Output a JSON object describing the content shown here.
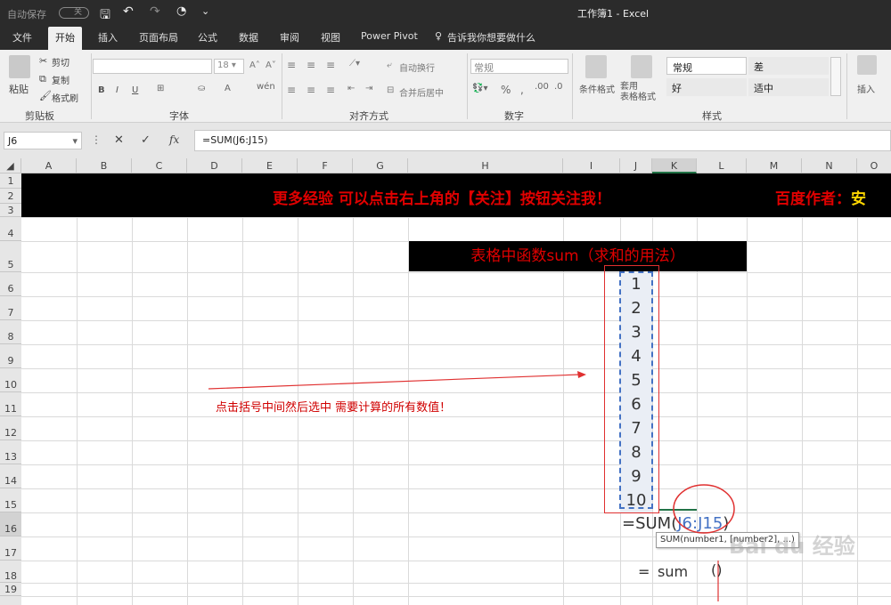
{
  "titlebar": {
    "autosave": "自动保存",
    "toggle": "关",
    "title": "工作簿1  -  Excel"
  },
  "tabs": [
    "文件",
    "开始",
    "插入",
    "页面布局",
    "公式",
    "数据",
    "审阅",
    "视图",
    "Power Pivot"
  ],
  "tell_me": "告诉我你想要做什么",
  "ribbon": {
    "paste": "粘贴",
    "cut": "剪切",
    "copy": "复制",
    "format_painter": "格式刷",
    "clipboard": "剪贴板",
    "font_size": "18",
    "font_group": "字体",
    "wrap": "自动换行",
    "merge": "合并后居中",
    "align_group": "对齐方式",
    "number_format": "常规",
    "number_group": "数字",
    "cond_format": "条件格式",
    "table_format": "套用\n表格格式",
    "style_normal": "常规",
    "style_bad": "差",
    "style_good": "好",
    "style_neutral": "适中",
    "style_group": "样式",
    "insert": "插入"
  },
  "formula_bar": {
    "name_box": "J6",
    "formula": "=SUM(J6:J15)"
  },
  "columns": [
    "A",
    "B",
    "C",
    "D",
    "E",
    "F",
    "G",
    "H",
    "I",
    "J",
    "K",
    "L",
    "M",
    "N",
    "O"
  ],
  "rows": [
    "1",
    "2",
    "3",
    "4",
    "5",
    "6",
    "7",
    "8",
    "9",
    "10",
    "11",
    "12",
    "13",
    "14",
    "15",
    "16",
    "17",
    "18",
    "19"
  ],
  "sheet": {
    "banner": "更多经验 可以点击右上角的【关注】按钮关注我！",
    "author": "百度作者：安",
    "header_box": "表格中函数sum（求和的用法）",
    "values": [
      "1",
      "2",
      "3",
      "4",
      "5",
      "6",
      "7",
      "8",
      "9",
      "10"
    ],
    "annotation": "点击括号中间然后选中 需要计算的所有数值！",
    "formula_eq": "=SUM(",
    "formula_ref": "J6:J15",
    "formula_close": ")",
    "tooltip": "SUM(number1, [number2], ...)",
    "bottom_eq": "=",
    "bottom_sum": "sum",
    "bottom_paren": "()"
  },
  "watermark": "Bai du 经验",
  "colors": {
    "banner_text": "#e00000",
    "author_text": "#ffd700",
    "ref_blue": "#4472c4",
    "annotation": "#d00000"
  }
}
